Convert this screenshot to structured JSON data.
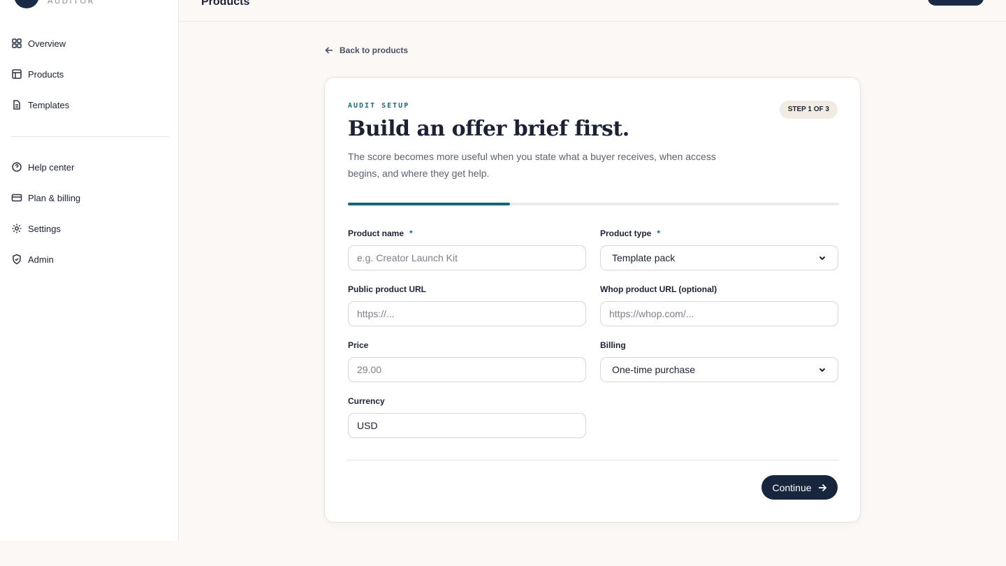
{
  "brand": {
    "name": "AUDITOR"
  },
  "sidebar": {
    "primary": [
      {
        "label": "Overview",
        "icon": "grid-icon"
      },
      {
        "label": "Products",
        "icon": "table-icon"
      },
      {
        "label": "Templates",
        "icon": "document-icon"
      }
    ],
    "secondary": [
      {
        "label": "Help center",
        "icon": "help-circle-icon"
      },
      {
        "label": "Plan & billing",
        "icon": "credit-card-icon"
      },
      {
        "label": "Settings",
        "icon": "gear-icon"
      },
      {
        "label": "Admin",
        "icon": "shield-icon"
      }
    ]
  },
  "header": {
    "title": "Products"
  },
  "back_link": {
    "label": "Back to products"
  },
  "card": {
    "eyebrow": "AUDIT SETUP",
    "step": "STEP 1 OF 3",
    "title": "Build an offer brief first.",
    "subtitle_line1": "The score becomes more useful when you state what a buyer receives, when access",
    "subtitle_line2": "begins, and where they get help.",
    "progress": 0.33,
    "accent_color": "#126a70"
  },
  "form": {
    "product_name": {
      "label": "Product name",
      "required": "*",
      "value": "",
      "placeholder": "e.g. Creator Launch Kit"
    },
    "product_type": {
      "label": "Product type",
      "required": "*",
      "value": "Template pack"
    },
    "public_url": {
      "label": "Public product URL",
      "value": "",
      "placeholder": "https://..."
    },
    "whop_url": {
      "label": "Whop product URL (optional)",
      "value": "",
      "placeholder": "https://whop.com/..."
    },
    "price": {
      "label": "Price",
      "value": "",
      "placeholder": "29.00"
    },
    "billing": {
      "label": "Billing",
      "value": "One-time purchase"
    },
    "currency": {
      "label": "Currency",
      "value": "USD"
    }
  },
  "actions": {
    "continue_label": "Continue"
  }
}
